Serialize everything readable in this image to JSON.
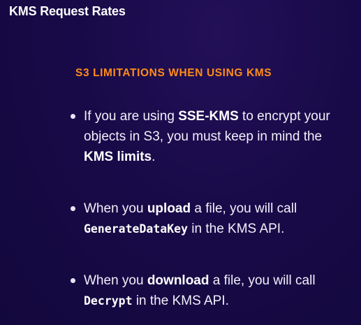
{
  "slide": {
    "title": "KMS Request Rates",
    "heading": "S3 LIMITATIONS WHEN USING KMS"
  },
  "bullets": [
    {
      "t1": "If you are using ",
      "b1": "SSE-KMS",
      "t2": " to encrypt your objects in S3, you must keep in mind the ",
      "b2": "KMS limits",
      "t3": "."
    },
    {
      "t1": "When you ",
      "b1": "upload",
      "t2": " a file, you will call ",
      "code": "GenerateDataKey",
      "t3": " in the KMS API."
    },
    {
      "t1": "When you ",
      "b1": "download",
      "t2": " a file, you will call ",
      "code": "Decrypt",
      "t3": " in the KMS API."
    }
  ]
}
